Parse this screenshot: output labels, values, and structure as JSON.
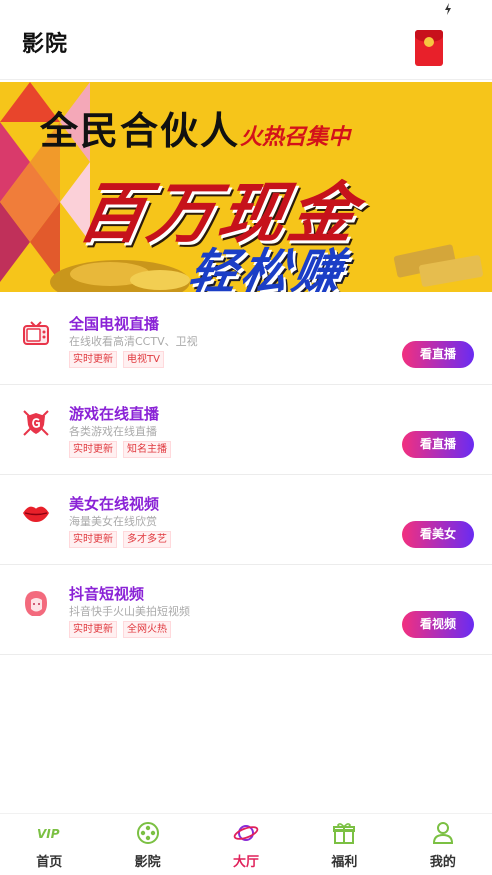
{
  "header": {
    "title": "影院"
  },
  "banner": {
    "line1": "全民合伙人",
    "line1_hot": "火热召集中",
    "line2": "百万现金",
    "line3": "轻松赚"
  },
  "items": [
    {
      "name": "全国电视直播",
      "desc": "在线收看高清CCTV、卫视",
      "tags": [
        "实时更新",
        "电视TV"
      ],
      "button": "看直播",
      "icon": "tv-icon"
    },
    {
      "name": "游戏在线直播",
      "desc": "各类游戏在线直播",
      "tags": [
        "实时更新",
        "知名主播"
      ],
      "button": "看直播",
      "icon": "game-shield-icon"
    },
    {
      "name": "美女在线视频",
      "desc": "海量美女在线欣赏",
      "tags": [
        "实时更新",
        "多才多艺"
      ],
      "button": "看美女",
      "icon": "lips-icon"
    },
    {
      "name": "抖音短视频",
      "desc": "抖音快手火山美拍短视频",
      "tags": [
        "实时更新",
        "全网火热"
      ],
      "button": "看视频",
      "icon": "girl-face-icon"
    }
  ],
  "tabbar": {
    "tabs": [
      {
        "label": "首页",
        "icon": "vip-icon"
      },
      {
        "label": "影院",
        "icon": "film-reel-icon"
      },
      {
        "label": "大厅",
        "icon": "planet-icon",
        "active": true
      },
      {
        "label": "福利",
        "icon": "gift-icon"
      },
      {
        "label": "我的",
        "icon": "user-icon"
      }
    ]
  },
  "colors": {
    "accent_purple": "#8a22d6",
    "button_gradient_start": "#f2307f",
    "button_gradient_end": "#6a2bf2",
    "tab_active": "#e0215a",
    "tag_red": "#e0393f",
    "banner_yellow": "#f7c71b"
  }
}
